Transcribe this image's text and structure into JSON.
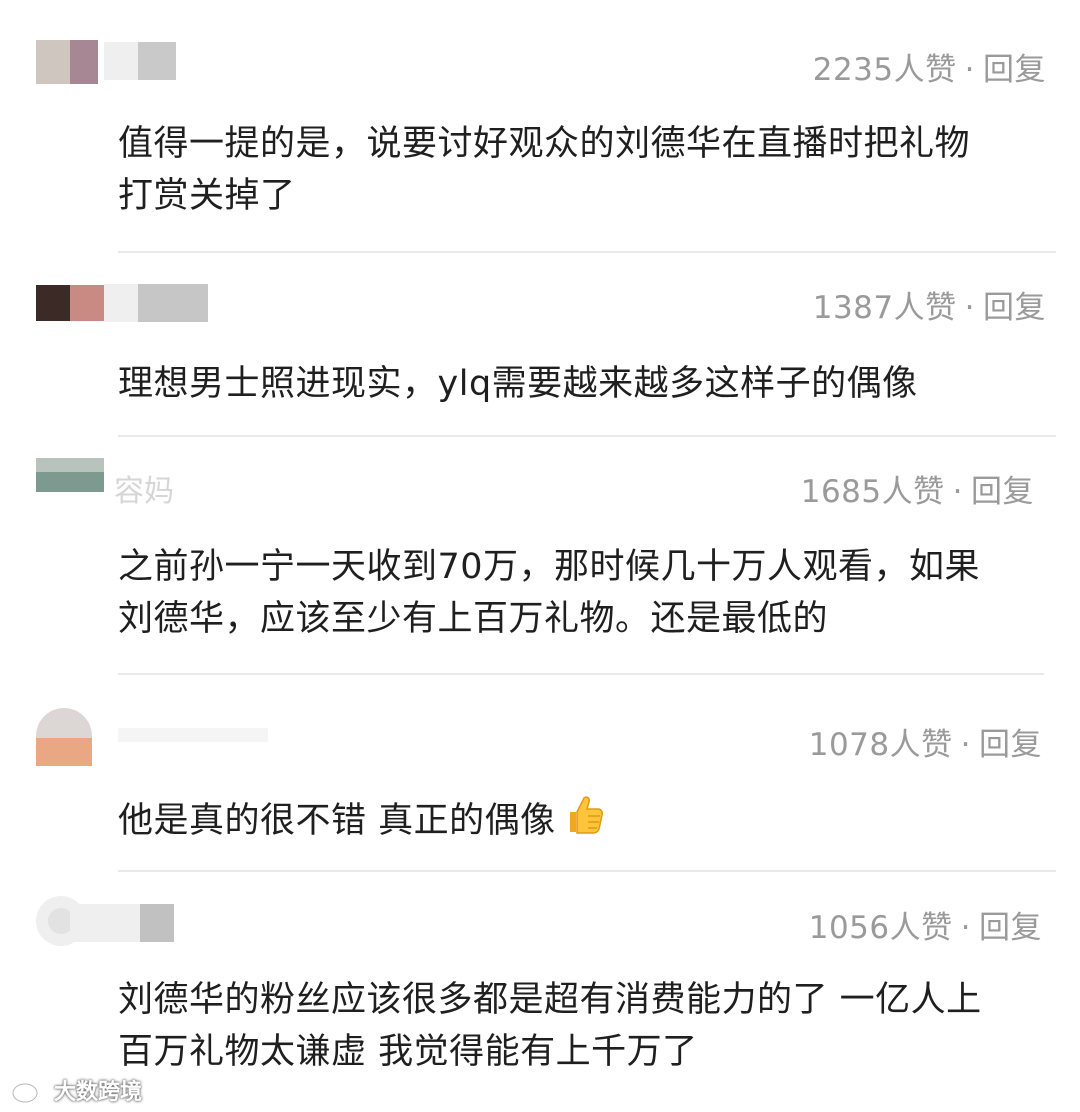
{
  "comments": [
    {
      "likes": "2235人赞",
      "separator": "·",
      "reply": "回复",
      "lines": [
        "值得一提的是，说要讨好观众的刘德华在直播时把礼物",
        "打赏关掉了"
      ]
    },
    {
      "likes": "1387人赞",
      "separator": "·",
      "reply": "回复",
      "lines": [
        "理想男士照进现实，ylq需要越来越多这样子的偶像"
      ]
    },
    {
      "username_partial": "容妈",
      "likes": "1685人赞",
      "separator": "·",
      "reply": "回复",
      "lines": [
        "之前孙一宁一天收到70万，那时候几十万人观看，如果",
        "刘德华，应该至少有上百万礼物。还是最低的"
      ]
    },
    {
      "likes": "1078人赞",
      "separator": "·",
      "reply": "回复",
      "lines": [
        "他是真的很不错 真正的偶像"
      ],
      "emoji": "thumbs-up"
    },
    {
      "likes": "1056人赞",
      "separator": "·",
      "reply": "回复",
      "lines": [
        "刘德华的粉丝应该很多都是超有消费能力的了 一亿人上",
        "百万礼物太谦虚 我觉得能有上千万了"
      ]
    }
  ],
  "watermark": {
    "text": "大数跨境",
    "icon": "weibo-logo-icon"
  }
}
